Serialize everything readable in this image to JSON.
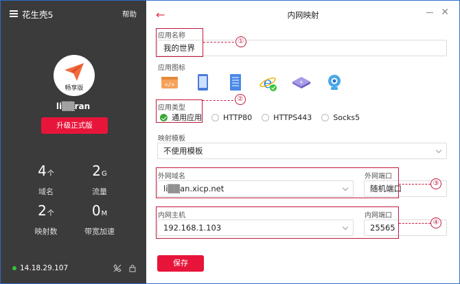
{
  "sidebar": {
    "app_title": "花生壳5",
    "help": "帮助",
    "avatar_badge": "畅享版",
    "username": "li▒▒ran",
    "upgrade_button": "升级正式版",
    "stats": [
      {
        "value": "4",
        "unit": "个",
        "label": "域名"
      },
      {
        "value": "2",
        "unit": "G",
        "label": "流量"
      },
      {
        "value": "2",
        "unit": "个",
        "label": "映射数"
      },
      {
        "value": "0",
        "unit": "M",
        "label": "带宽加速"
      }
    ],
    "ip": "14.18.29.107"
  },
  "header": {
    "back": "←",
    "title": "内网映射",
    "close": "✕"
  },
  "form": {
    "app_name_label": "应用名称",
    "app_name_value": "我的世界",
    "app_icon_label": "应用图标",
    "icons": [
      "code-icon",
      "tablet-icon",
      "document-icon",
      "ie-icon",
      "router-icon",
      "webcam-icon"
    ],
    "app_type_label": "应用类型",
    "app_types": [
      "通用应用",
      "HTTP80",
      "HTTPS443",
      "Socks5"
    ],
    "selected_app_type": "通用应用",
    "template_label": "映射模板",
    "template_value": "不使用模板",
    "ext_domain_label": "外网域名",
    "ext_domain_value": "li▒▒an.xicp.net",
    "ext_port_label": "外网端口",
    "ext_port_value": "随机端口",
    "int_host_label": "内网主机",
    "int_host_value": "192.168.1.103",
    "int_port_label": "内网端口",
    "int_port_value": "25565",
    "save_button": "保存"
  },
  "annotations": [
    "①",
    "②",
    "③",
    "④"
  ],
  "colors": {
    "sidebar_bg": "#3b3b3b",
    "accent": "#e8153a",
    "annotation": "#c0183d",
    "online": "#35c435"
  }
}
